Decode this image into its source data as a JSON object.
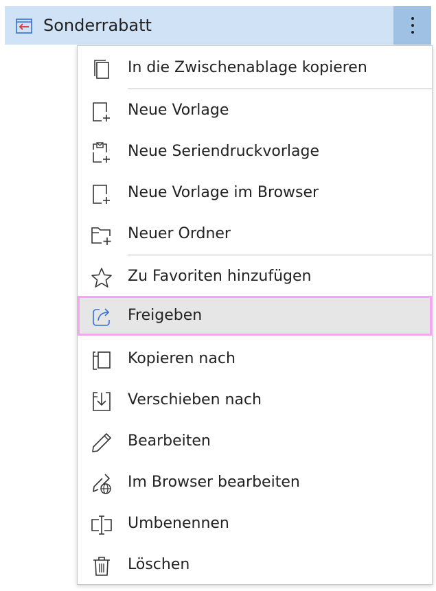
{
  "header": {
    "title": "Sonderrabatt",
    "title_icon": "template-back-icon",
    "more_icon": "more-vertical-icon"
  },
  "menu": {
    "items": [
      {
        "label": "In die Zwischenablage kopieren",
        "icon": "copy-icon"
      },
      {
        "label": "Neue Vorlage",
        "icon": "new-template-icon"
      },
      {
        "label": "Neue Seriendruckvorlage",
        "icon": "new-mail-merge-template-icon"
      },
      {
        "label": "Neue Vorlage im Browser",
        "icon": "new-template-browser-icon"
      },
      {
        "label": "Neuer Ordner",
        "icon": "new-folder-icon"
      },
      {
        "label": "Zu Favoriten hinzufügen",
        "icon": "star-icon"
      },
      {
        "label": "Freigeben",
        "icon": "share-icon"
      },
      {
        "label": "Kopieren nach",
        "icon": "copy-to-icon"
      },
      {
        "label": "Verschieben nach",
        "icon": "move-to-icon"
      },
      {
        "label": "Bearbeiten",
        "icon": "pencil-icon"
      },
      {
        "label": "Im Browser bearbeiten",
        "icon": "edit-in-browser-icon"
      },
      {
        "label": "Umbenennen",
        "icon": "rename-icon"
      },
      {
        "label": "Löschen",
        "icon": "trash-icon"
      }
    ],
    "highlighted": "Freigeben"
  },
  "colors": {
    "header_bg": "#cfe2f6",
    "more_button_bg": "#9ec1e4",
    "highlight_bg": "#e6e6e6",
    "highlight_border": "#f4a6f2",
    "accent": "#2f6fd6",
    "red_arrow": "#e0323b"
  }
}
